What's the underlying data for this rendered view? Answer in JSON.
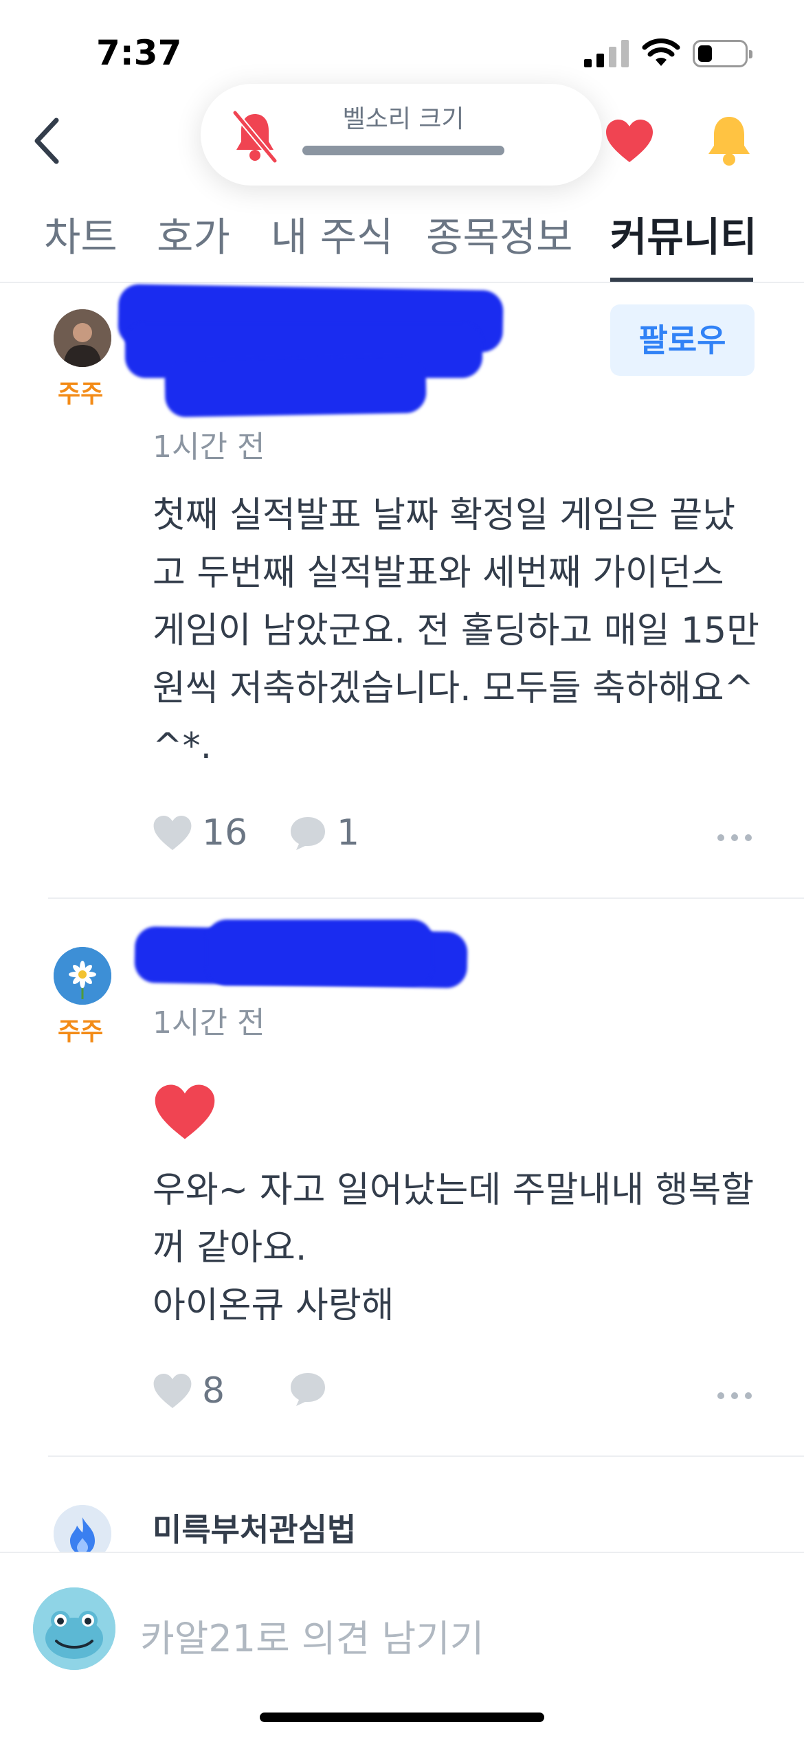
{
  "status_bar": {
    "time": "7:37"
  },
  "header": {
    "back_icon": "chevron-left-icon",
    "volume_label": "벨소리 크기",
    "heart_color": "#f04452",
    "bell_color": "#ffc342",
    "mute_color": "#f04452"
  },
  "tabs": [
    {
      "label": "차트",
      "active": false
    },
    {
      "label": "호가",
      "active": false
    },
    {
      "label": "내 주식",
      "active": false
    },
    {
      "label": "종목정보",
      "active": false
    },
    {
      "label": "커뮤니티",
      "active": true
    }
  ],
  "posts": [
    {
      "badge": "주주",
      "time": "1시간 전",
      "follow_label": "팔로우",
      "lines": [
        "첫째 실적발표 날짜 확정일 게임은 끝났",
        "고 두번째 실적발표와 세번째 가이던스",
        "게임이 남았군요. 전 홀딩하고 매일 15만",
        "원씩 저축하겠습니다. 모두들 축하해요^",
        "^*."
      ],
      "likes": "16",
      "comments": "1"
    },
    {
      "badge": "주주",
      "time": "1시간 전",
      "lines": [
        "우와~ 자고 일어났는데 주말내내 행복할",
        "꺼 같아요.",
        "아이온큐 사랑해"
      ],
      "likes": "8",
      "comments": ""
    },
    {
      "author": "미륵부처관심법"
    }
  ],
  "composer": {
    "placeholder": "카알21로 의견 남기기"
  },
  "colors": {
    "accent_blue": "#3182f6",
    "badge_orange": "#f38b17",
    "redaction_blue": "#1a2cf0"
  }
}
